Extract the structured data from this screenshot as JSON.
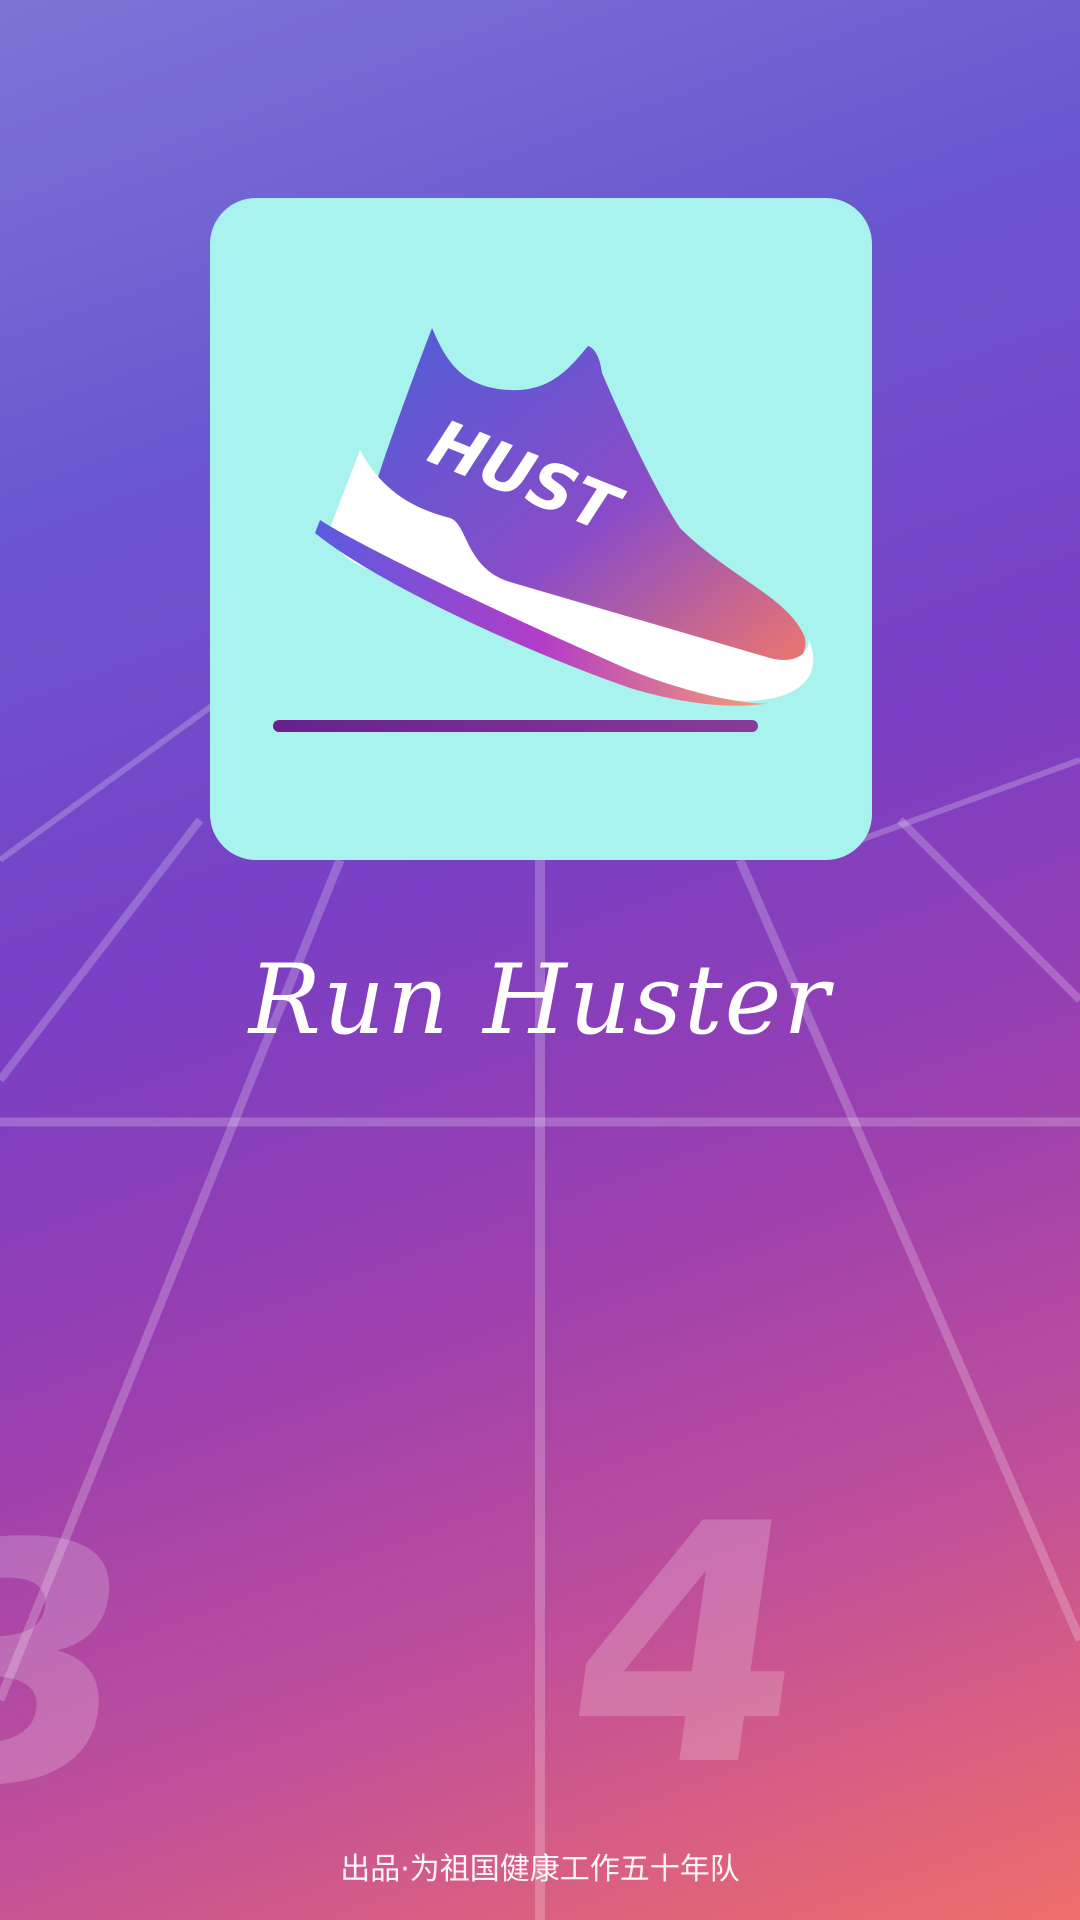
{
  "splash": {
    "logo_text": "HUST",
    "app_title": "Run Huster",
    "footer_credit": "出品·为祖国健康工作五十年队",
    "track_lane_numbers": [
      "3",
      "4"
    ]
  },
  "colors": {
    "logo_background": "#a8f3ee",
    "gradient_top": "#7d74d6",
    "gradient_bottom": "#ef6e6a",
    "shoe_blue": "#4e5ed8",
    "shoe_pink": "#e56b8f",
    "ground_line": "#7a2a9a"
  }
}
